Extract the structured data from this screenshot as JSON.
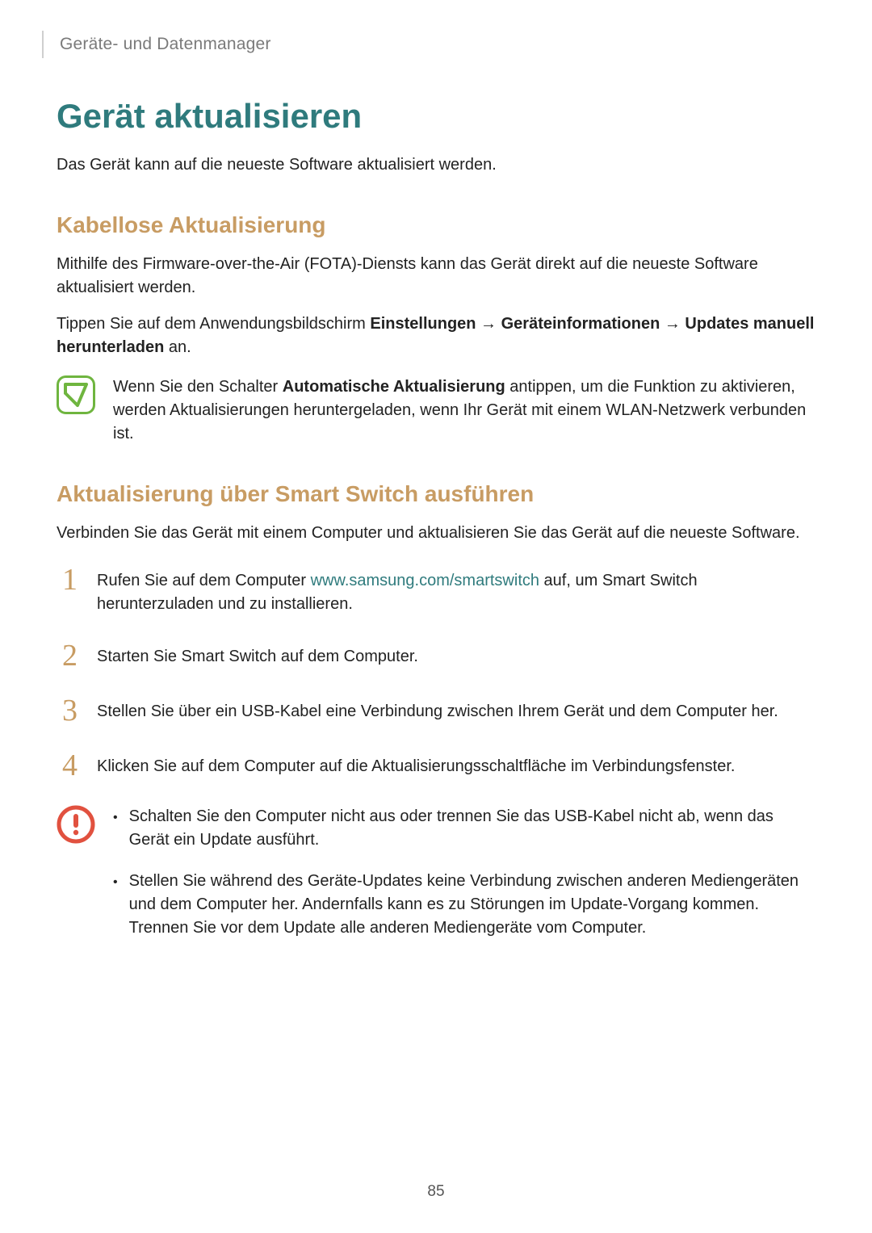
{
  "breadcrumb": "Geräte- und Datenmanager",
  "title": "Gerät aktualisieren",
  "intro": "Das Gerät kann auf die neueste Software aktualisiert werden.",
  "section1": {
    "heading": "Kabellose Aktualisierung",
    "p1": "Mithilfe des Firmware-over-the-Air (FOTA)-Diensts kann das Gerät direkt auf die neueste Software aktualisiert werden.",
    "p2_pre": "Tippen Sie auf dem Anwendungsbildschirm ",
    "p2_bold": "Einstellungen → Geräteinformationen → Updates manuell herunterladen",
    "p2_post": " an.",
    "note_pre": "Wenn Sie den Schalter ",
    "note_bold": "Automatische Aktualisierung",
    "note_post": " antippen, um die Funktion zu aktivieren, werden Aktualisierungen heruntergeladen, wenn Ihr Gerät mit einem WLAN-Netzwerk verbunden ist."
  },
  "section2": {
    "heading": "Aktualisierung über Smart Switch ausführen",
    "p1": "Verbinden Sie das Gerät mit einem Computer und aktualisieren Sie das Gerät auf die neueste Software.",
    "steps": {
      "n1": "1",
      "s1_pre": "Rufen Sie auf dem Computer ",
      "s1_link": "www.samsung.com/smartswitch",
      "s1_post": " auf, um Smart Switch herunterzuladen und zu installieren.",
      "n2": "2",
      "s2": "Starten Sie Smart Switch auf dem Computer.",
      "n3": "3",
      "s3": "Stellen Sie über ein USB-Kabel eine Verbindung zwischen Ihrem Gerät und dem Computer her.",
      "n4": "4",
      "s4": "Klicken Sie auf dem Computer auf die Aktualisierungsschaltfläche im Verbindungsfenster."
    },
    "warnings": {
      "b1": "Schalten Sie den Computer nicht aus oder trennen Sie das USB-Kabel nicht ab, wenn das Gerät ein Update ausführt.",
      "b2": "Stellen Sie während des Geräte-Updates keine Verbindung zwischen anderen Mediengeräten und dem Computer her. Andernfalls kann es zu Störungen im Update-Vorgang kommen. Trennen Sie vor dem Update alle anderen Mediengeräte vom Computer."
    }
  },
  "bullet_char": "•",
  "page_number": "85"
}
